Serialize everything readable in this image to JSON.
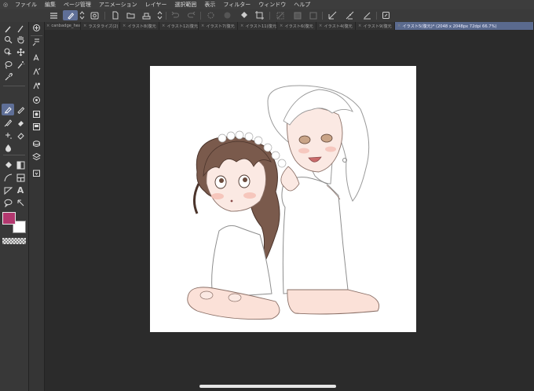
{
  "menu": {
    "app_icon": "clip-studio-icon",
    "items": [
      "ファイル",
      "編集",
      "ページ管理",
      "アニメーション",
      "レイヤー",
      "選択範囲",
      "表示",
      "フィルター",
      "ウィンドウ",
      "ヘルプ"
    ]
  },
  "tabs": [
    {
      "label": "canbadge_heac"
    },
    {
      "label": "ラスタライズ(2)"
    },
    {
      "label": "イラスト8(復元"
    },
    {
      "label": "イラスト12(復元"
    },
    {
      "label": "イラスト7(復元"
    },
    {
      "label": "イラスト11(復元"
    },
    {
      "label": "イラスト6(復元"
    },
    {
      "label": "イラスト4(復元"
    },
    {
      "label": "イラスト9(復元"
    },
    {
      "label": "イラスト5(復元)* (2048 x 2048px 72dpi 66.7%)",
      "active": true
    }
  ],
  "colors": {
    "main": "#b3386f",
    "sub": "#ffffff",
    "accent": "#5f6f97"
  },
  "artwork": {
    "description_icon": "illustration-two-girls"
  }
}
